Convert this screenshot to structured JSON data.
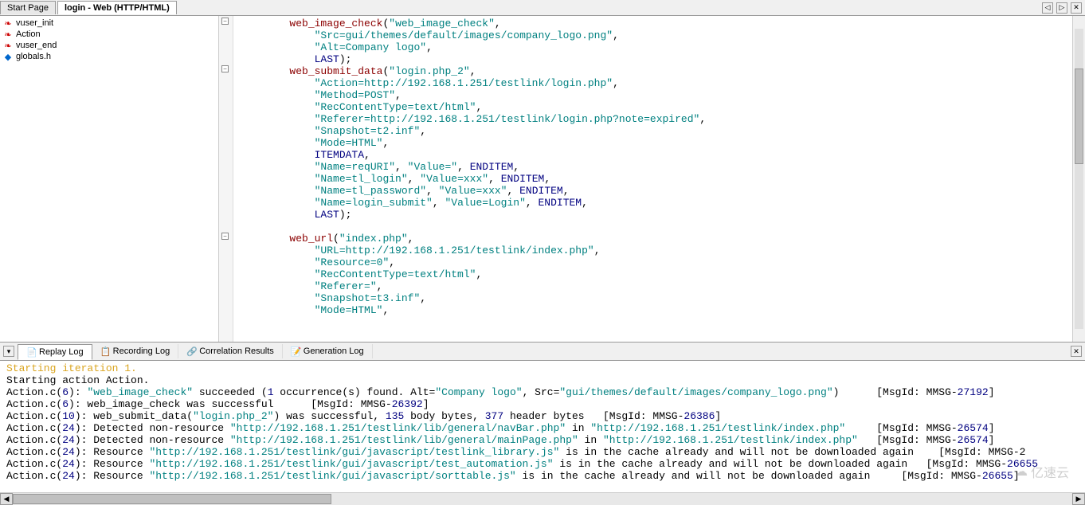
{
  "tabs": {
    "start": "Start Page",
    "login": "login - Web (HTTP/HTML)"
  },
  "tab_controls": {
    "left": "◁",
    "right": "▷",
    "close": "✕"
  },
  "tree": [
    {
      "label": "vuser_init",
      "icon": "red"
    },
    {
      "label": "Action",
      "icon": "red"
    },
    {
      "label": "vuser_end",
      "icon": "red"
    },
    {
      "label": "globals.h",
      "icon": "blue"
    }
  ],
  "code_tokens": [
    [
      {
        "fn": "web_image_check"
      },
      {
        "p": "("
      },
      {
        "str": "\"web_image_check\""
      },
      {
        "p": ","
      }
    ],
    [
      {
        "indent": 1
      },
      {
        "str": "\"Src=gui/themes/default/images/company_logo.png\""
      },
      {
        "p": ","
      }
    ],
    [
      {
        "indent": 1
      },
      {
        "str": "\"Alt=Company logo\""
      },
      {
        "p": ","
      }
    ],
    [
      {
        "indent": 1
      },
      {
        "kw": "LAST"
      },
      {
        "p": ");"
      }
    ],
    [
      {
        "fn": "web_submit_data"
      },
      {
        "p": "("
      },
      {
        "str": "\"login.php_2\""
      },
      {
        "p": ","
      }
    ],
    [
      {
        "indent": 1
      },
      {
        "str": "\"Action=http://192.168.1.251/testlink/login.php\""
      },
      {
        "p": ","
      }
    ],
    [
      {
        "indent": 1
      },
      {
        "str": "\"Method=POST\""
      },
      {
        "p": ","
      }
    ],
    [
      {
        "indent": 1
      },
      {
        "str": "\"RecContentType=text/html\""
      },
      {
        "p": ","
      }
    ],
    [
      {
        "indent": 1
      },
      {
        "str": "\"Referer=http://192.168.1.251/testlink/login.php?note=expired\""
      },
      {
        "p": ","
      }
    ],
    [
      {
        "indent": 1
      },
      {
        "str": "\"Snapshot=t2.inf\""
      },
      {
        "p": ","
      }
    ],
    [
      {
        "indent": 1
      },
      {
        "str": "\"Mode=HTML\""
      },
      {
        "p": ","
      }
    ],
    [
      {
        "indent": 1
      },
      {
        "kw": "ITEMDATA"
      },
      {
        "p": ","
      }
    ],
    [
      {
        "indent": 1
      },
      {
        "str": "\"Name=reqURI\""
      },
      {
        "p": ", "
      },
      {
        "str": "\"Value=\""
      },
      {
        "p": ", "
      },
      {
        "kw": "ENDITEM"
      },
      {
        "p": ","
      }
    ],
    [
      {
        "indent": 1
      },
      {
        "str": "\"Name=tl_login\""
      },
      {
        "p": ", "
      },
      {
        "str": "\"Value=xxx\""
      },
      {
        "p": ", "
      },
      {
        "kw": "ENDITEM"
      },
      {
        "p": ","
      }
    ],
    [
      {
        "indent": 1
      },
      {
        "str": "\"Name=tl_password\""
      },
      {
        "p": ", "
      },
      {
        "str": "\"Value=xxx\""
      },
      {
        "p": ", "
      },
      {
        "kw": "ENDITEM"
      },
      {
        "p": ","
      }
    ],
    [
      {
        "indent": 1
      },
      {
        "str": "\"Name=login_submit\""
      },
      {
        "p": ", "
      },
      {
        "str": "\"Value=Login\""
      },
      {
        "p": ", "
      },
      {
        "kw": "ENDITEM"
      },
      {
        "p": ","
      }
    ],
    [
      {
        "indent": 1
      },
      {
        "kw": "LAST"
      },
      {
        "p": ");"
      }
    ],
    [],
    [
      {
        "fn": "web_url"
      },
      {
        "p": "("
      },
      {
        "str": "\"index.php\""
      },
      {
        "p": ","
      }
    ],
    [
      {
        "indent": 1
      },
      {
        "str": "\"URL=http://192.168.1.251/testlink/index.php\""
      },
      {
        "p": ","
      }
    ],
    [
      {
        "indent": 1
      },
      {
        "str": "\"Resource=0\""
      },
      {
        "p": ","
      }
    ],
    [
      {
        "indent": 1
      },
      {
        "str": "\"RecContentType=text/html\""
      },
      {
        "p": ","
      }
    ],
    [
      {
        "indent": 1
      },
      {
        "str": "\"Referer=\""
      },
      {
        "p": ","
      }
    ],
    [
      {
        "indent": 1
      },
      {
        "str": "\"Snapshot=t3.inf\""
      },
      {
        "p": ","
      }
    ],
    [
      {
        "indent": 1
      },
      {
        "str": "\"Mode=HTML\""
      },
      {
        "p": ","
      }
    ]
  ],
  "log_tabs": {
    "replay": "Replay Log",
    "recording": "Recording Log",
    "correlation": "Correlation Results",
    "generation": "Generation Log"
  },
  "log_lines": [
    [
      {
        "orange": "Starting iteration 1."
      }
    ],
    [
      {
        "p": "Starting action Action."
      }
    ],
    [
      {
        "p": "Action.c("
      },
      {
        "num": "6"
      },
      {
        "p": "): "
      },
      {
        "teal": "\"web_image_check\""
      },
      {
        "p": " succeeded ("
      },
      {
        "num": "1"
      },
      {
        "p": " occurrence(s) found. Alt="
      },
      {
        "teal": "\"Company logo\""
      },
      {
        "p": ", Src="
      },
      {
        "teal": "\"gui/themes/default/images/company_logo.png\""
      },
      {
        "p": ")      [MsgId: MMSG-"
      },
      {
        "num": "27192"
      },
      {
        "p": "]"
      }
    ],
    [
      {
        "p": "Action.c("
      },
      {
        "num": "6"
      },
      {
        "p": "): web_image_check was successful      [MsgId: MMSG-"
      },
      {
        "num": "26392"
      },
      {
        "p": "]"
      }
    ],
    [
      {
        "p": "Action.c("
      },
      {
        "num": "10"
      },
      {
        "p": "): web_submit_data("
      },
      {
        "teal": "\"login.php_2\""
      },
      {
        "p": ") was successful, "
      },
      {
        "num": "135"
      },
      {
        "p": " body bytes, "
      },
      {
        "num": "377"
      },
      {
        "p": " header bytes   [MsgId: MMSG-"
      },
      {
        "num": "26386"
      },
      {
        "p": "]"
      }
    ],
    [
      {
        "p": "Action.c("
      },
      {
        "num": "24"
      },
      {
        "p": "): Detected non-resource "
      },
      {
        "teal": "\"http://192.168.1.251/testlink/lib/general/navBar.php\""
      },
      {
        "p": " in "
      },
      {
        "teal": "\"http://192.168.1.251/testlink/index.php\""
      },
      {
        "p": "     [MsgId: MMSG-"
      },
      {
        "num": "26574"
      },
      {
        "p": "]"
      }
    ],
    [
      {
        "p": "Action.c("
      },
      {
        "num": "24"
      },
      {
        "p": "): Detected non-resource "
      },
      {
        "teal": "\"http://192.168.1.251/testlink/lib/general/mainPage.php\""
      },
      {
        "p": " in "
      },
      {
        "teal": "\"http://192.168.1.251/testlink/index.php\""
      },
      {
        "p": "   [MsgId: MMSG-"
      },
      {
        "num": "26574"
      },
      {
        "p": "]"
      }
    ],
    [
      {
        "p": "Action.c("
      },
      {
        "num": "24"
      },
      {
        "p": "): Resource "
      },
      {
        "teal": "\"http://192.168.1.251/testlink/gui/javascript/testlink_library.js\""
      },
      {
        "p": " is in the cache already and will not be downloaded again    [MsgId: MMSG-2"
      }
    ],
    [
      {
        "p": "Action.c("
      },
      {
        "num": "24"
      },
      {
        "p": "): Resource "
      },
      {
        "teal": "\"http://192.168.1.251/testlink/gui/javascript/test_automation.js\""
      },
      {
        "p": " is in the cache already and will not be downloaded again   [MsgId: MMSG-"
      },
      {
        "num": "26655"
      }
    ],
    [
      {
        "p": "Action.c("
      },
      {
        "num": "24"
      },
      {
        "p": "): Resource "
      },
      {
        "teal": "\"http://192.168.1.251/testlink/gui/javascript/sorttable.js\""
      },
      {
        "p": " is in the cache already and will not be downloaded again     [MsgId: MMSG-"
      },
      {
        "num": "26655"
      },
      {
        "p": "]"
      }
    ]
  ],
  "watermark": "亿速云"
}
